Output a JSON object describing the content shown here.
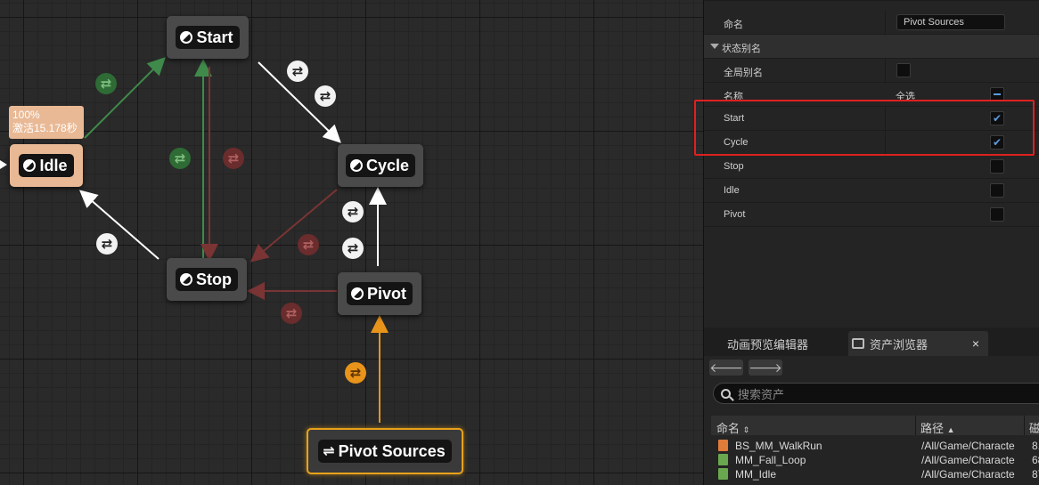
{
  "graph": {
    "nodes": {
      "start": "Start",
      "idle": "Idle",
      "cycle": "Cycle",
      "stop": "Stop",
      "pivot": "Pivot",
      "pivot_sources": "Pivot Sources"
    },
    "tooltip": {
      "line1": "100%",
      "line2": "激活15.178秒"
    },
    "colors": {
      "active_edge": "#ffffff",
      "green_edge": "#3f8a4a",
      "red_edge": "#7a3434",
      "orange_edge": "#e8941a",
      "idle_node": "#e9b995"
    }
  },
  "details": {
    "name_row": {
      "label": "命名",
      "value": "Pivot Sources"
    },
    "category": {
      "label": "状态别名"
    },
    "global_alias": {
      "label": "全局别名"
    },
    "name_header": {
      "label": "名称",
      "select_all": "全选"
    },
    "states": [
      {
        "label": "Start",
        "checked": true
      },
      {
        "label": "Cycle",
        "checked": true
      },
      {
        "label": "Stop",
        "checked": false
      },
      {
        "label": "Idle",
        "checked": false
      },
      {
        "label": "Pivot",
        "checked": false
      }
    ],
    "highlight_color": "#e02020"
  },
  "bottom": {
    "tabs": {
      "preview": "动画预览编辑器",
      "assets": "资产浏览器",
      "close": "×"
    },
    "nav": {
      "back": "🡐",
      "forward": "🡒"
    },
    "search": {
      "placeholder": "搜索资产"
    },
    "columns": {
      "name": "命名",
      "path": "路径",
      "disk": "磁"
    },
    "assets": [
      {
        "name": "BS_MM_WalkRun",
        "path": "/All/Game/Characte",
        "size": "8.",
        "icon_color": "#e07b39"
      },
      {
        "name": "MM_Fall_Loop",
        "path": "/All/Game/Characte",
        "size": "68",
        "icon_color": "#6aa84f"
      },
      {
        "name": "MM_Idle",
        "path": "/All/Game/Characte",
        "size": "87",
        "icon_color": "#6aa84f"
      }
    ]
  }
}
